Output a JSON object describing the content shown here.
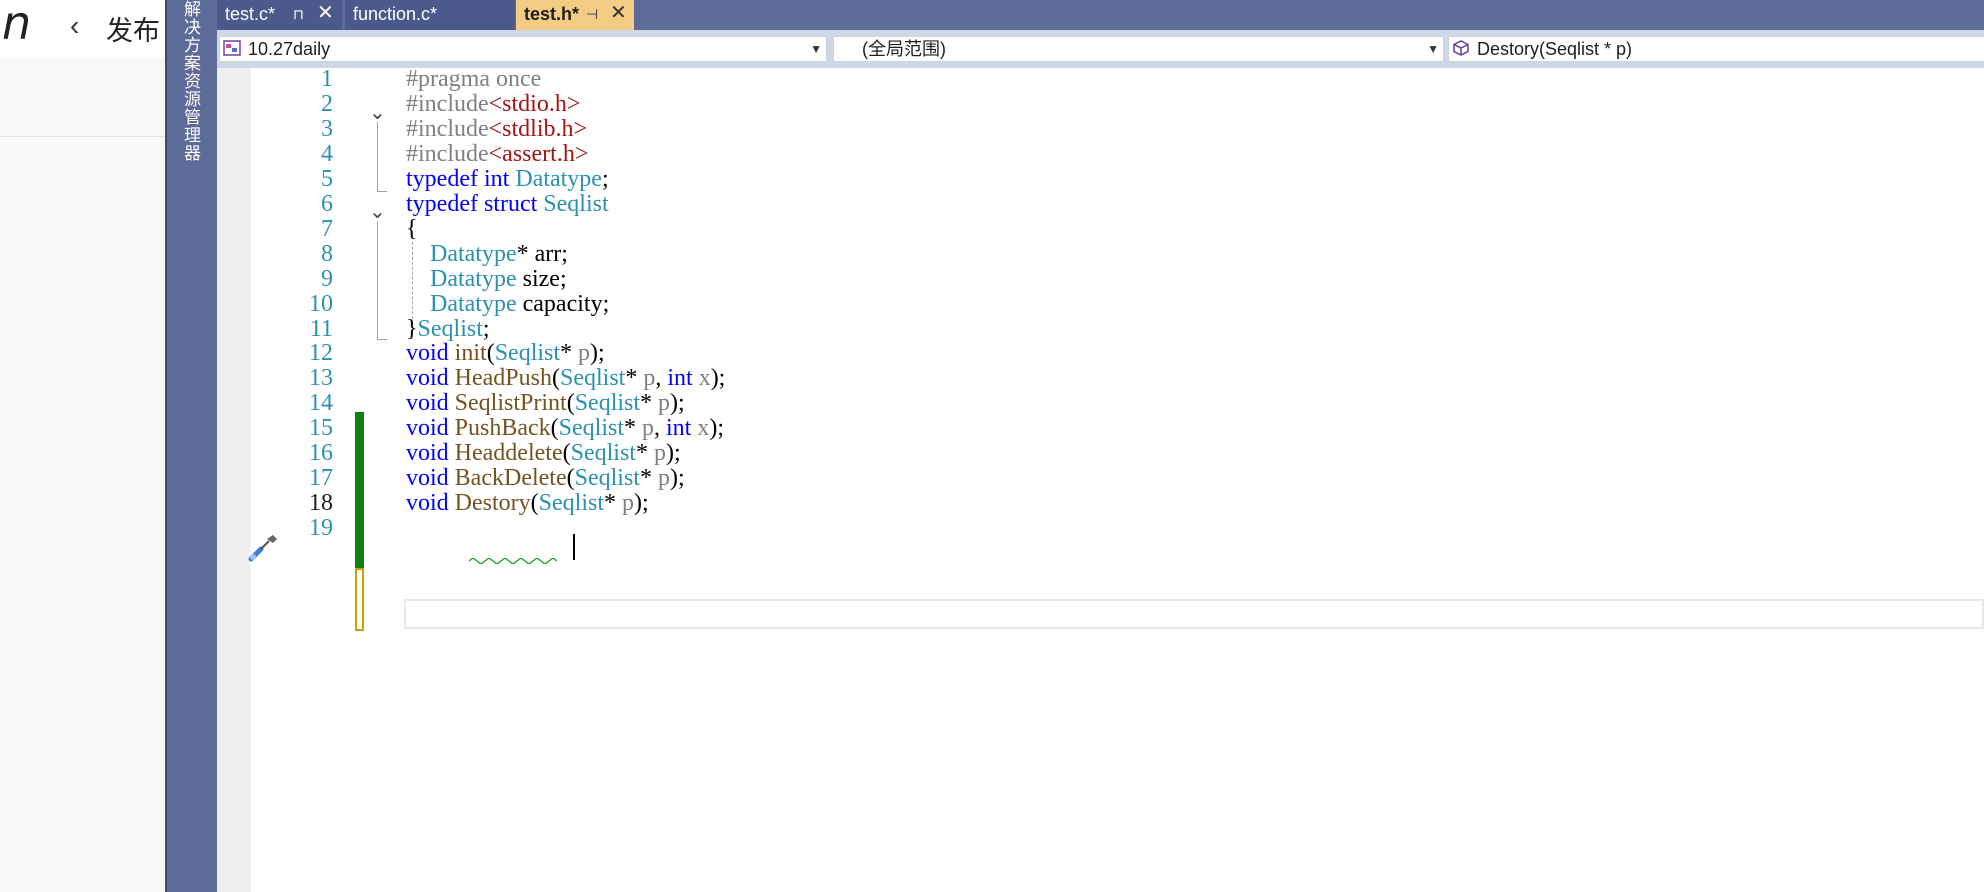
{
  "background_app": {
    "logo": "n",
    "back_arrow": "‹",
    "title": "发布"
  },
  "solution_explorer_tab": "解决方案资源管理器",
  "tabs": [
    {
      "label": "test.c*",
      "pinned": true,
      "active": false
    },
    {
      "label": "function.c*",
      "pinned": false,
      "active": false
    },
    {
      "label": "test.h*",
      "pinned": true,
      "active": true
    }
  ],
  "navbar": {
    "project": "10.27daily",
    "scope": "(全局范围)",
    "member": "Destory(Seqlist * p)"
  },
  "editor": {
    "line_numbers": [
      "1",
      "2",
      "3",
      "4",
      "5",
      "6",
      "7",
      "8",
      "9",
      "10",
      "11",
      "12",
      "13",
      "14",
      "15",
      "16",
      "17",
      "18",
      "19"
    ],
    "current_line": 18
  },
  "colors": {
    "tab_bar": "#5d6b99",
    "active_tab": "#f5cc84",
    "keyword": "#0000ff",
    "type": "#2b91af",
    "function": "#74531f",
    "string": "#a31515",
    "change_saved": "#108010",
    "change_unsaved": "#c8a000"
  }
}
